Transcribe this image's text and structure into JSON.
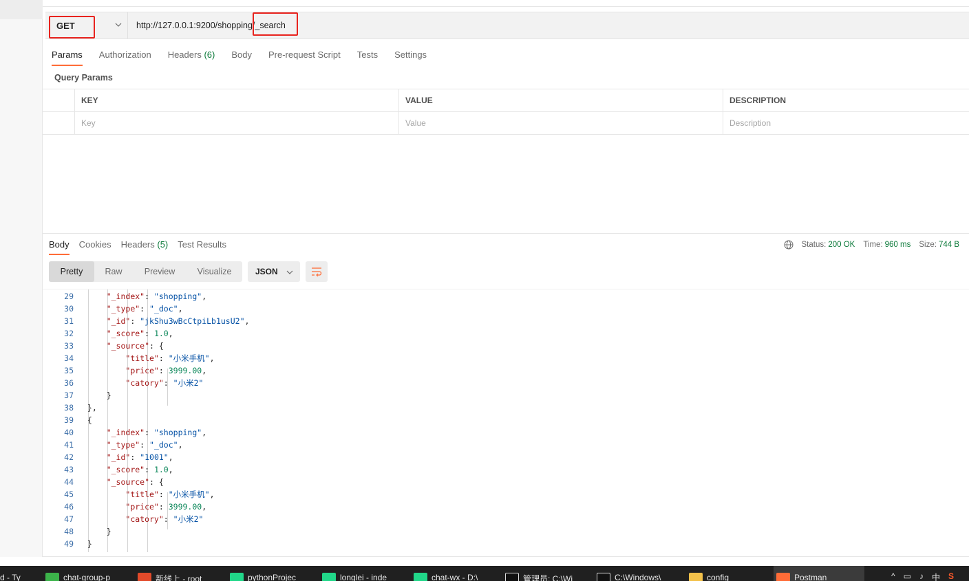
{
  "request": {
    "method": "GET",
    "url_base": "http://127.0.0.1:9200/shopping",
    "url_path": "/_search"
  },
  "request_tabs": [
    {
      "label": "Params",
      "count": ""
    },
    {
      "label": "Authorization",
      "count": ""
    },
    {
      "label": "Headers ",
      "count": "(6)"
    },
    {
      "label": "Body",
      "count": ""
    },
    {
      "label": "Pre-request Script",
      "count": ""
    },
    {
      "label": "Tests",
      "count": ""
    },
    {
      "label": "Settings",
      "count": ""
    }
  ],
  "query_params": {
    "title": "Query Params",
    "headers": {
      "key": "KEY",
      "value": "VALUE",
      "description": "DESCRIPTION"
    },
    "placeholders": {
      "key": "Key",
      "value": "Value",
      "description": "Description"
    }
  },
  "response_tabs": [
    {
      "label": "Body",
      "count": ""
    },
    {
      "label": "Cookies",
      "count": ""
    },
    {
      "label": "Headers ",
      "count": "(5)"
    },
    {
      "label": "Test Results",
      "count": ""
    }
  ],
  "status": {
    "status_label": "Status:",
    "status_value": "200 OK",
    "time_label": "Time:",
    "time_value": "960 ms",
    "size_label": "Size:",
    "size_value": "744 B"
  },
  "view_modes": [
    "Pretty",
    "Raw",
    "Preview",
    "Visualize"
  ],
  "format": "JSON",
  "colors": {
    "accent": "#ff6c37",
    "success": "#0c7a3a",
    "highlight": "#e8231e"
  },
  "code_lines": [
    {
      "n": "29",
      "text": "                \"_index\": \"shopping\","
    },
    {
      "n": "30",
      "text": "                \"_type\": \"_doc\","
    },
    {
      "n": "31",
      "text": "                \"_id\": \"jkShu3wBcCtpiLb1usU2\","
    },
    {
      "n": "32",
      "text": "                \"_score\": 1.0,"
    },
    {
      "n": "33",
      "text": "                \"_source\": {"
    },
    {
      "n": "34",
      "text": "                    \"title\": \"小米手机\","
    },
    {
      "n": "35",
      "text": "                    \"price\": 3999.00,"
    },
    {
      "n": "36",
      "text": "                    \"catory\": \"小米2\""
    },
    {
      "n": "37",
      "text": "                }"
    },
    {
      "n": "38",
      "text": "            },"
    },
    {
      "n": "39",
      "text": "            {"
    },
    {
      "n": "40",
      "text": "                \"_index\": \"shopping\","
    },
    {
      "n": "41",
      "text": "                \"_type\": \"_doc\","
    },
    {
      "n": "42",
      "text": "                \"_id\": \"1001\","
    },
    {
      "n": "43",
      "text": "                \"_score\": 1.0,"
    },
    {
      "n": "44",
      "text": "                \"_source\": {"
    },
    {
      "n": "45",
      "text": "                    \"title\": \"小米手机\","
    },
    {
      "n": "46",
      "text": "                    \"price\": 3999.00,"
    },
    {
      "n": "47",
      "text": "                    \"catory\": \"小米2\""
    },
    {
      "n": "48",
      "text": "                }"
    },
    {
      "n": "49",
      "text": "            }"
    }
  ],
  "taskbar": [
    {
      "label": "d - Ty",
      "icon": "app-icon"
    },
    {
      "label": "chat-group-p",
      "icon": "wechat-devtools-icon"
    },
    {
      "label": "新线上 - root",
      "icon": "db-client-icon"
    },
    {
      "label": "pythonProjec",
      "icon": "pycharm-icon"
    },
    {
      "label": "longlei - inde",
      "icon": "pycharm-icon"
    },
    {
      "label": "chat-wx - D:\\",
      "icon": "pycharm-icon"
    },
    {
      "label": "管理员: C:\\Wi",
      "icon": "cmd-icon"
    },
    {
      "label": "C:\\Windows\\",
      "icon": "cmd-icon"
    },
    {
      "label": "config",
      "icon": "folder-icon"
    },
    {
      "label": "Postman",
      "icon": "postman-icon"
    }
  ],
  "tray": [
    "^",
    "中"
  ]
}
